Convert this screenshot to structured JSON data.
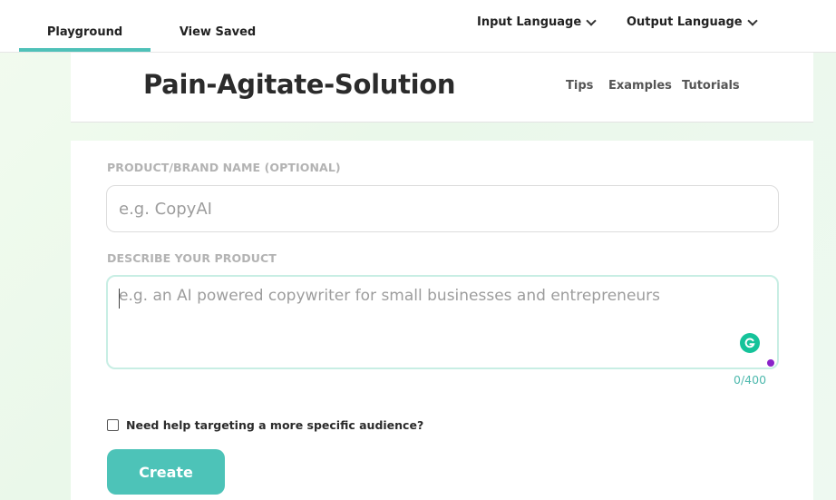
{
  "nav": {
    "tabs": [
      {
        "label": "Playground",
        "active": true
      },
      {
        "label": "View Saved",
        "active": false
      }
    ],
    "input_language": "Input Language",
    "output_language": "Output Language",
    "accent_color": "#4fc1b8"
  },
  "header": {
    "title": "Pain-Agitate-Solution",
    "links": [
      "Tips",
      "Examples",
      "Tutorials"
    ]
  },
  "form": {
    "product_label": "PRODUCT/BRAND NAME (OPTIONAL)",
    "product_placeholder": "e.g. CopyAI",
    "product_value": "",
    "describe_label": "DESCRIBE YOUR PRODUCT",
    "describe_placeholder": "e.g. an AI powered copywriter for small businesses and entrepreneurs",
    "describe_value": "",
    "char_count": "0/400",
    "audience_checkbox_label": "Need help targeting a more specific audience?",
    "audience_checked": false,
    "create_label": "Create",
    "button_color": "#4dc3b8"
  },
  "icons": {
    "grammarly": "grammarly-icon",
    "chevron": "chevron-down-icon"
  }
}
